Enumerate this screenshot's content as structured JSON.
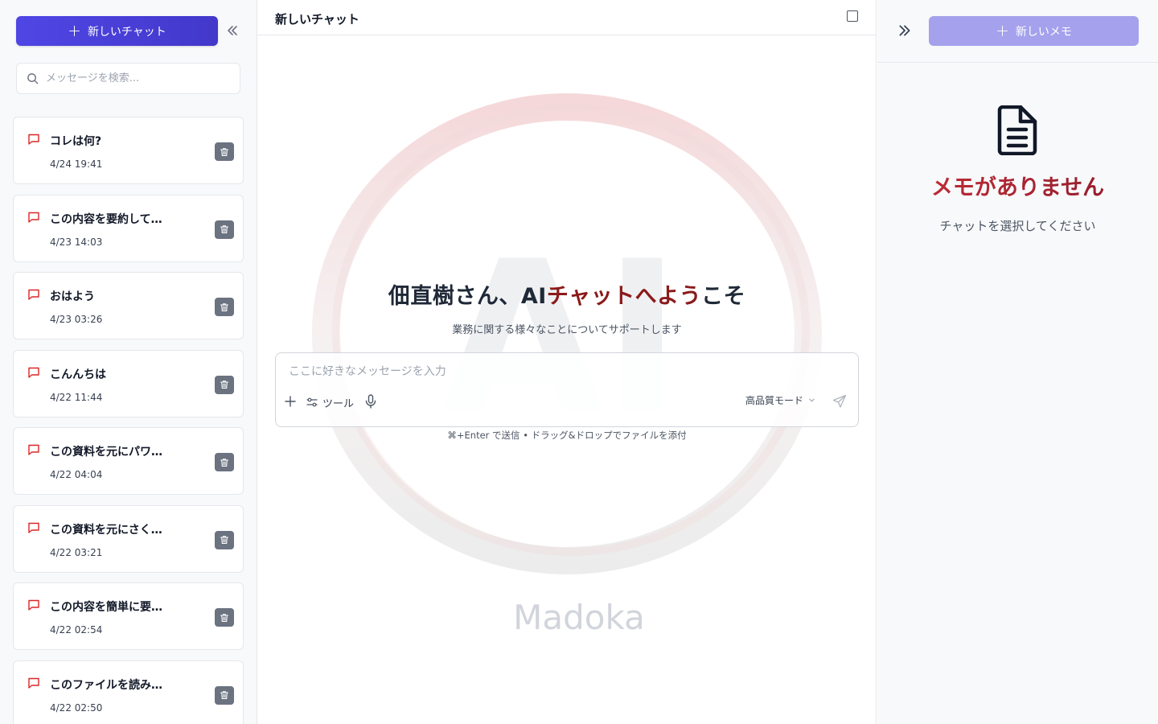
{
  "sidebar": {
    "new_chat_label": "新しいチャット",
    "search_placeholder": "メッセージを検索...",
    "chats": [
      {
        "title": "コレは何?",
        "time": "4/24 19:41"
      },
      {
        "title": "この内容を要約して…",
        "time": "4/23 14:03"
      },
      {
        "title": "おはよう",
        "time": "4/23 03:26"
      },
      {
        "title": "こんんちは",
        "time": "4/22 11:44"
      },
      {
        "title": "この資料を元にパワ…",
        "time": "4/22 04:04"
      },
      {
        "title": "この資料を元にさく…",
        "time": "4/22 03:21"
      },
      {
        "title": "この内容を簡単に要…",
        "time": "4/22 02:54"
      },
      {
        "title": "このファイルを読み…",
        "time": "4/22 02:50"
      }
    ]
  },
  "main": {
    "title": "新しいチャット",
    "welcome_prefix": "佃直樹さん、AI",
    "welcome_accent": "チャットへよう",
    "welcome_suffix": "こそ",
    "subtitle": "業務に関する様々なことについてサポートします",
    "input_placeholder": "ここに好きなメッセージを入力",
    "tools_label": "ツール",
    "mode_label": "高品質モード",
    "hint": "⌘+Enter で送信 • ドラッグ&ドロップでファイルを添付",
    "watermark_text": "Madoka",
    "watermark_letters": "AI"
  },
  "memo": {
    "new_memo_label": "新しいメモ",
    "empty_title": "メモがありません",
    "empty_hint": "チャットを選択してください"
  },
  "colors": {
    "primary": "#4f46e5",
    "primary_disabled": "#a5a1ec",
    "accent_red": "#c8303a",
    "dark_red": "#8b1a1a"
  }
}
